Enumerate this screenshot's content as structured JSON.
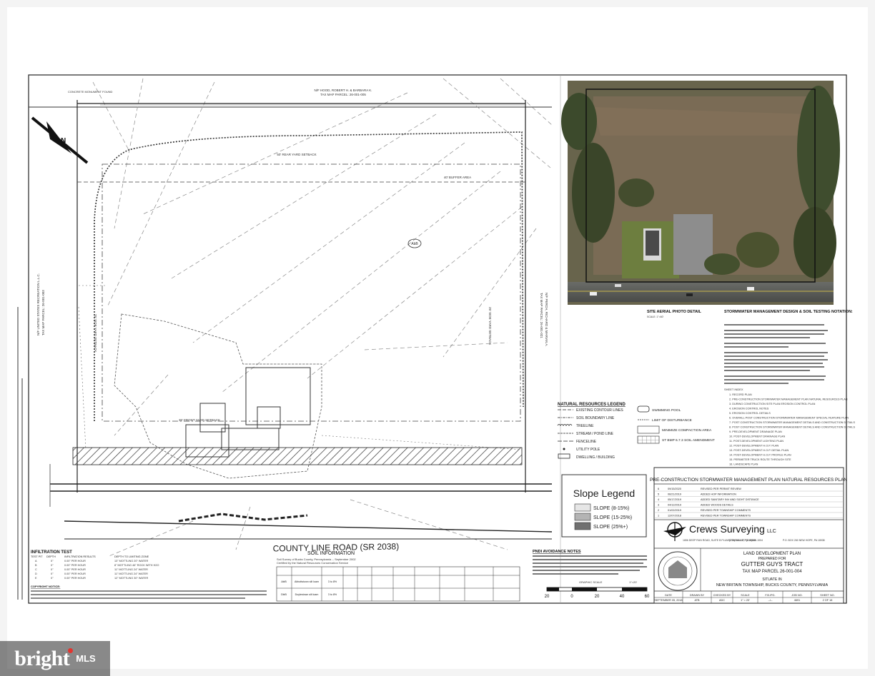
{
  "plan": {
    "neighbor_top": "N/F HOOD, ROBERT H. & BARBARA K.",
    "neighbor_top_parcel": "TAX MAP PARCEL: 26-001-005",
    "neighbor_left": "N/F UNITED STATES RECREATION L.L.C.",
    "neighbor_left_parcel": "TAX MAP PARCEL: 26-001-003",
    "neighbor_right": "N/F PERCH, RICHARD & MARIAN A.",
    "neighbor_right_parcel": "TAX MAP PARCEL: 26-001-021",
    "concrete_monument": "CONCRETE MONUMENT FOUND",
    "rear_setback": "50' REAR YARD SETBACK",
    "buffer_area": "40' BUFFER AREA",
    "side_setback": "25' SIDE YARD SETBACK",
    "front_setback": "35' FRONT YARD SETBACK",
    "road_name": "COUNTY LINE ROAD (SR 2038)",
    "soil_tag": "AbB",
    "north_label": "N"
  },
  "aerial": {
    "title": "SITE AERIAL PHOTO DETAIL",
    "scale": "SCALE: 1\"=60'"
  },
  "stormwater": {
    "title": "STORMWATER MANAGEMENT DESIGN & SOIL TESTING NOTATION:",
    "sheet_index_title": "SHEET INDEX",
    "sheet_index": [
      "1. RECORD PLAN",
      "2. PRE-CONSTRUCTION STORMWATER MANAGEMENT PLAN NATURAL RESOURCES PLAN",
      "3. DURING CONSTRUCTION SITE PLAN EROSION CONTROL PLAN",
      "4. EROSION CONTROL NOTES",
      "5. EROSION CONTROL DETAILS",
      "6. OVERALL POST CONSTRUCTION STORMWATER MANAGEMENT SPECIAL FEATURE PLAN",
      "7. POST CONSTRUCTION STORMWATER MANAGEMENT DETAILS AND CONSTRUCTION DETAILS",
      "8. POST CONSTRUCTION STORMWATER MANAGEMENT DETAILS AND CONSTRUCTION DETAILS",
      "9. PRE-DEVELOPMENT DRAINAGE PLAN",
      "10. POST-DEVELOPMENT DRAINAGE PLAN",
      "11. POST-DEVELOPMENT LIGHTING PLAN",
      "12. POST-DEVELOPMENT H.O.P. PLAN",
      "13. POST-DEVELOPMENT H.O.P. DETAIL PLAN",
      "14. POST-DEVELOPMENT H.O.P. PROFILE PLAN",
      "15. PERIMETER TRUCK ROUTE THROUGH SITE",
      "16. LANDSCAPE PLAN",
      "17. PHASE 2 SITE PLAN",
      "18. PHASE 2 EROSION CONTROL NOTES"
    ]
  },
  "legend": {
    "title": "NATURAL RESOURCES LEGEND",
    "items": [
      {
        "sym": "contour",
        "label": "EXISTING CONTOUR LINES"
      },
      {
        "sym": "soil",
        "label": "SOIL BOUNDARY LINE"
      },
      {
        "sym": "tree",
        "label": "TREELINE"
      },
      {
        "sym": "stream",
        "label": "STREAM / POND LINE"
      },
      {
        "sym": "fence",
        "label": "FENCELINE"
      },
      {
        "sym": "pole",
        "label": "UTILITY POLE"
      },
      {
        "sym": "dwelling",
        "label": "DWELLING / BUILDING"
      }
    ],
    "items_right": [
      {
        "sym": "pool",
        "label": "SWIMMING POOL"
      },
      {
        "sym": "disturb",
        "label": "LIMIT OF DISTURBANCE"
      },
      {
        "sym": "minimize",
        "label": "MINIMIZE COMPACTION AREA"
      },
      {
        "sym": "amend",
        "label": "ST BMP 6.7.3 SOIL AMENDMENT"
      }
    ]
  },
  "slope_legend": {
    "title": "Slope Legend",
    "items": [
      {
        "label": "SLOPE (8-15%)",
        "color": "#e6e6e6"
      },
      {
        "label": "SLOPE (15-25%)",
        "color": "#b4b4b4"
      },
      {
        "label": "SLOPE (25%+)",
        "color": "#707070"
      }
    ]
  },
  "title_block": {
    "plan_title": "PRE-CONSTRUCTION STORMWATER MANAGEMENT PLAN NATURAL RESOURCES PLAN",
    "revisions": [
      {
        "no": "6",
        "date": "09/15/2020",
        "desc": "REVISED PER PERMIT REVIEW"
      },
      {
        "no": "5",
        "date": "06/21/2019",
        "desc": "ADDED HOP INFORMATION"
      },
      {
        "no": "4",
        "date": "05/17/2019",
        "desc": "ADDED SANITARY INV AND SIGHT DISTANCE"
      },
      {
        "no": "3",
        "date": "04/12/2019",
        "desc": "ADDED WOODS DETAILS"
      },
      {
        "no": "2",
        "date": "01/02/2019",
        "desc": "REVISED PER TOWNSHIP COMMENTS"
      },
      {
        "no": "1",
        "date": "12/07/2018",
        "desc": "REVISED PER TOWNSHIP COMMENTS"
      }
    ],
    "company": "Crews Surveying",
    "company_suffix": "LLC",
    "company_address": "1656 DEEP RUN ROAD, SUITE B PLUMSTEADVILLE, PA 18949",
    "company_phone": "(215)766-0377 (215)840-1904",
    "company_po": "P.O. BOX 260 NEW HOPE, PA 18938",
    "project_type": "LAND DEVELOPMENT PLAN",
    "prepared_for": "PREPARED FOR",
    "tract": "GUTTER GUYS TRACT",
    "parcel": "TAX MAP PARCEL 26-001-004",
    "situate": "SITUATE IN",
    "township": "NEW BRITAIN TOWNSHIP, BUCKS COUNTY, PENNSYLVANIA",
    "footer_headers": [
      "DATE",
      "DRAWN BY",
      "CHECKED BY",
      "SCALE",
      "F.B./PG.",
      "JOB NO.",
      "SHEET NO."
    ],
    "footer_values": [
      "SEPTEMBER 05, 2018",
      "ATB",
      "ADC",
      "1\" = 20'",
      "--/--",
      "4691",
      "2 OF 18"
    ]
  },
  "graphic_scale": {
    "title": "GRAPHIC SCALE",
    "unit": "1\"=20'",
    "ticks": [
      "20",
      "0",
      "20",
      "40",
      "60"
    ]
  },
  "infiltration": {
    "title": "INFILTRATION TEST",
    "headers": [
      "TEST PIT",
      "DEPTH",
      "INFILTRATION RESULTS",
      "DEPTH TO LIMITING ZONE"
    ],
    "rows": [
      [
        "A",
        "0\"",
        "0.00\" PER HOUR",
        "13\" MOTTLING 20\" WATER"
      ],
      [
        "B",
        "0\"",
        "0.00\" PER HOUR",
        "8\" MOTTLING 46\" ROCK WITH H2O"
      ],
      [
        "C",
        "0\"",
        "0.00\" PER HOUR",
        "11\" MOTTLING 24\" WATER"
      ],
      [
        "D",
        "0\"",
        "0.00\" PER HOUR",
        "11\" MOTTLING 24\" WATER"
      ],
      [
        "E",
        "0\"",
        "0.00\" PER HOUR",
        "12\" MOTTLING 30\" WATER"
      ]
    ],
    "copyright": "COPYRIGHT NOTICE:"
  },
  "soil_info": {
    "title": "SOIL INFORMATION",
    "subtitle": "Soil Survey of Bucks County, Pennsylvania -- September 2002",
    "certified": "Certified by the Natural Resources Conservation Service",
    "rows": [
      {
        "sym": "AbB",
        "name": "Abbottstown silt loam",
        "slope": "3 to 8%"
      },
      {
        "sym": "DbB",
        "name": "Doylestown silt loam",
        "slope": "3 to 8%"
      }
    ]
  },
  "pnd_notes": {
    "title": "PNDI AVOIDANCE NOTES"
  },
  "watermark": {
    "brand": "bright",
    "suffix": "MLS"
  }
}
